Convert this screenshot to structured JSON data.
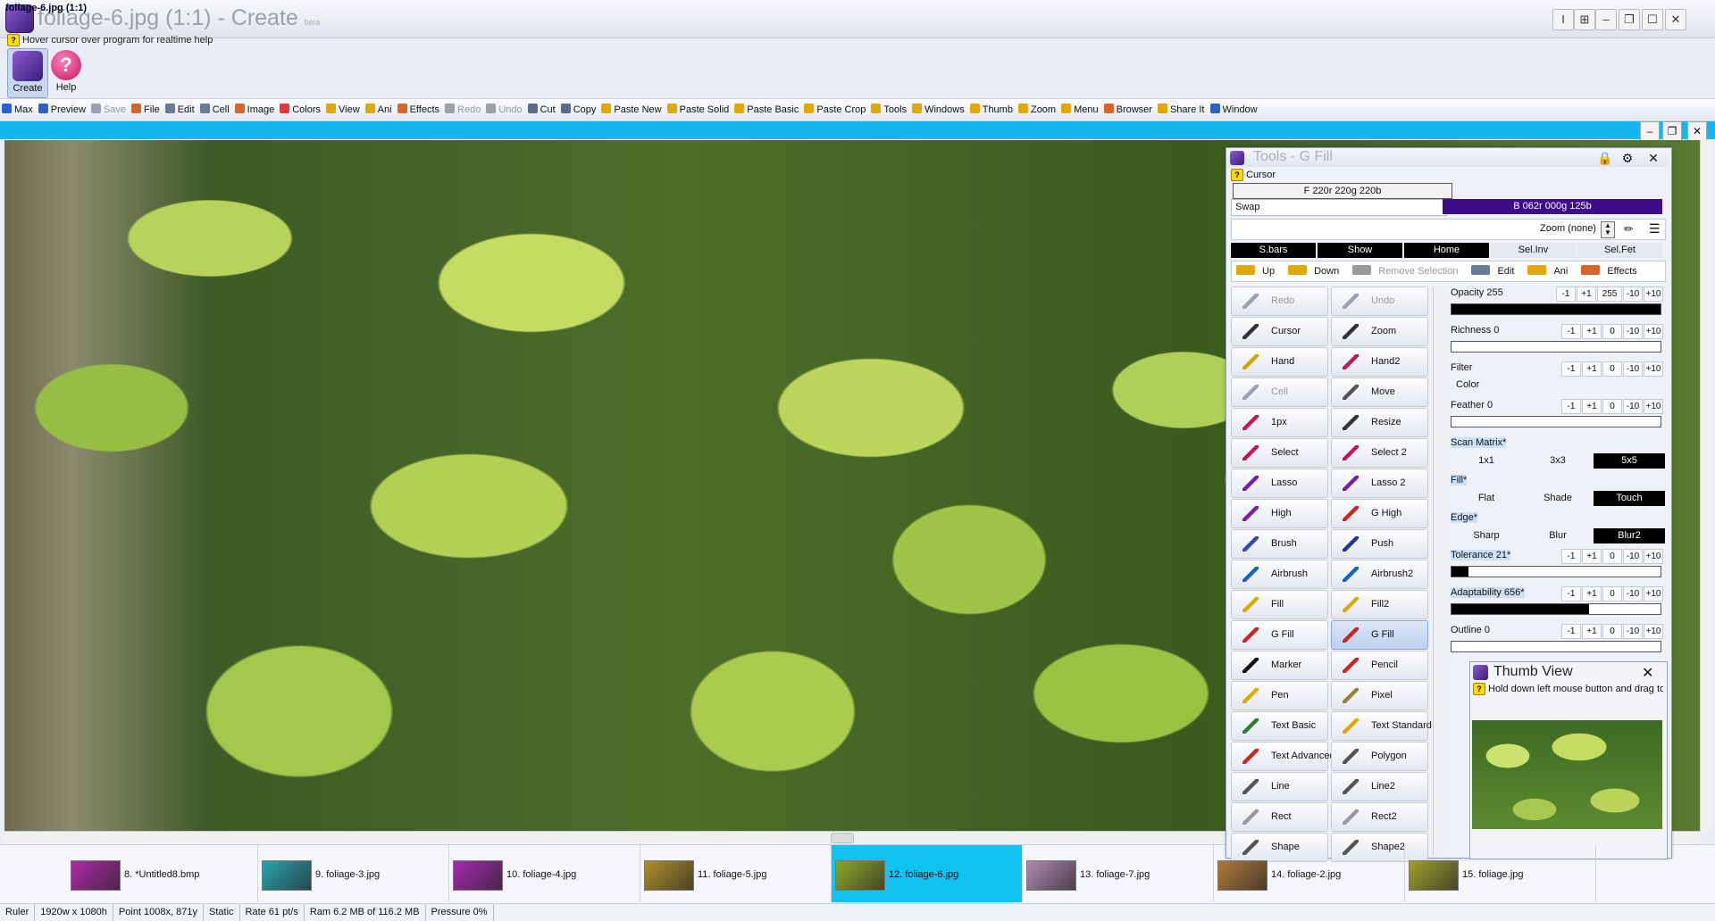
{
  "window": {
    "title": "foliage-6.jpg (1:1) - Create",
    "title_suffix": "beta",
    "hint": "Hover cursor over program for realtime help",
    "controls": [
      "I",
      "⊞",
      "–",
      "❐",
      "☐",
      "✕"
    ]
  },
  "big_buttons": {
    "create": "Create",
    "help": "Help"
  },
  "menubar": [
    {
      "label": "Max",
      "icon": "max-icon",
      "color": "#2a62c9",
      "enabled": true
    },
    {
      "label": "Preview",
      "icon": "preview-icon",
      "color": "#2a62c9",
      "enabled": true
    },
    {
      "label": "Save",
      "icon": "save-icon",
      "color": "#9aa0ad",
      "enabled": false
    },
    {
      "label": "File",
      "icon": "file-icon",
      "color": "#d9642a",
      "enabled": true
    },
    {
      "label": "Edit",
      "icon": "edit-icon",
      "color": "#6a7a9a",
      "enabled": true
    },
    {
      "label": "Cell",
      "icon": "cell-icon",
      "color": "#6a7a9a",
      "enabled": true
    },
    {
      "label": "Image",
      "icon": "image-icon",
      "color": "#d9642a",
      "enabled": true
    },
    {
      "label": "Colors",
      "icon": "colors-icon",
      "color": "#e53935",
      "enabled": true
    },
    {
      "label": "View",
      "icon": "view-icon",
      "color": "#e0a800",
      "enabled": true
    },
    {
      "label": "Ani",
      "icon": "ani-icon",
      "color": "#e0a800",
      "enabled": true
    },
    {
      "label": "Effects",
      "icon": "effects-icon",
      "color": "#d9642a",
      "enabled": true
    },
    {
      "label": "Redo",
      "icon": "redo-icon",
      "color": "#9aa0ad",
      "enabled": false
    },
    {
      "label": "Undo",
      "icon": "undo-icon",
      "color": "#9aa0ad",
      "enabled": false
    },
    {
      "label": "Cut",
      "icon": "cut-icon",
      "color": "#5a6b8c",
      "enabled": true
    },
    {
      "label": "Copy",
      "icon": "copy-icon",
      "color": "#5a6b8c",
      "enabled": true
    },
    {
      "label": "Paste New",
      "icon": "paste-icon",
      "color": "#e0a800",
      "enabled": true
    },
    {
      "label": "Paste Solid",
      "icon": "paste-icon",
      "color": "#e0a800",
      "enabled": true
    },
    {
      "label": "Paste Basic",
      "icon": "paste-icon",
      "color": "#e0a800",
      "enabled": true
    },
    {
      "label": "Paste Crop",
      "icon": "paste-icon",
      "color": "#e0a800",
      "enabled": true
    },
    {
      "label": "Tools",
      "icon": "tools-icon",
      "color": "#e0a800",
      "enabled": true
    },
    {
      "label": "Windows",
      "icon": "windows-icon",
      "color": "#e0a800",
      "enabled": true
    },
    {
      "label": "Thumb",
      "icon": "thumb-icon",
      "color": "#e0a800",
      "enabled": true
    },
    {
      "label": "Zoom",
      "icon": "zoom-icon",
      "color": "#e0a800",
      "enabled": true
    },
    {
      "label": "Menu",
      "icon": "menu-icon",
      "color": "#e0a800",
      "enabled": true
    },
    {
      "label": "Browser",
      "icon": "browser-icon",
      "color": "#d9642a",
      "enabled": true
    },
    {
      "label": "Share It",
      "icon": "share-icon",
      "color": "#e0a800",
      "enabled": true
    },
    {
      "label": "Window",
      "icon": "window-icon",
      "color": "#2a62c9",
      "enabled": true
    }
  ],
  "image_window": {
    "title": "foliage-6.jpg (1:1)",
    "controls": [
      "–",
      "❐",
      "✕"
    ]
  },
  "thumbnails": [
    {
      "label": "8. *Untitled8.bmp",
      "color": "#b02aa8",
      "active": false
    },
    {
      "label": "9. foliage-3.jpg",
      "color": "#2aa5b0",
      "active": false
    },
    {
      "label": "10. foliage-4.jpg",
      "color": "#a52ab0",
      "active": false
    },
    {
      "label": "11. foliage-5.jpg",
      "color": "#b0902a",
      "active": false
    },
    {
      "label": "12. foliage-6.jpg",
      "color": "#8aa82a",
      "active": true
    },
    {
      "label": "13. foliage-7.jpg",
      "color": "#b08ab0",
      "active": false
    },
    {
      "label": "14. foliage-2.jpg",
      "color": "#b07a3a",
      "active": false
    },
    {
      "label": "15. foliage.jpg",
      "color": "#a0a030",
      "active": false
    }
  ],
  "status": [
    "Ruler",
    "1920w x 1080h",
    "Point 1008x, 871y",
    "Static",
    "Rate 61 pt/s",
    "Ram 6.2 MB of 116.2 MB",
    "Pressure 0%"
  ],
  "tools_panel": {
    "title": "Tools - G Fill",
    "cursor_label": "Cursor",
    "fg_color": "F  220r 220g 220b",
    "swap": "Swap",
    "bg_color": "B  062r 000g 125b",
    "zoom": "Zoom  (none)",
    "tabs": [
      {
        "label": "S.bars",
        "dark": true
      },
      {
        "label": "Show",
        "dark": true
      },
      {
        "label": "Home",
        "dark": true
      },
      {
        "label": "Sel.Inv",
        "dark": false
      },
      {
        "label": "Sel.Fet",
        "dark": false
      }
    ],
    "subbar": [
      {
        "label": "Up",
        "icon": "up-arrow-icon",
        "enabled": true
      },
      {
        "label": "Down",
        "icon": "down-arrow-icon",
        "enabled": true
      },
      {
        "label": "Remove Selection",
        "icon": "remove-selection-icon",
        "enabled": false
      },
      {
        "label": "Edit",
        "icon": "edit-icon",
        "enabled": true
      },
      {
        "label": "Ani",
        "icon": "ani-icon",
        "enabled": true
      },
      {
        "label": "Effects",
        "icon": "effects-icon",
        "enabled": true
      }
    ],
    "tools": [
      {
        "label": "Redo",
        "icon": "redo-icon",
        "color": "#9aa0ad",
        "enabled": false
      },
      {
        "label": "Undo",
        "icon": "undo-icon",
        "color": "#9aa0ad",
        "enabled": false
      },
      {
        "label": "Cursor",
        "icon": "cursor-icon",
        "color": "#333333",
        "enabled": true
      },
      {
        "label": "Zoom",
        "icon": "zoom-icon",
        "color": "#333333",
        "enabled": true
      },
      {
        "label": "Hand",
        "icon": "hand-icon",
        "color": "#d9a200",
        "enabled": true
      },
      {
        "label": "Hand2",
        "icon": "hand2-icon",
        "color": "#c2185b",
        "enabled": true
      },
      {
        "label": "Cell",
        "icon": "cell-icon",
        "color": "#9aa0ad",
        "enabled": false
      },
      {
        "label": "Move",
        "icon": "move-icon",
        "color": "#555555",
        "enabled": true
      },
      {
        "label": "1px",
        "icon": "pencil-1px-icon",
        "color": "#c2185b",
        "enabled": true
      },
      {
        "label": "Resize",
        "icon": "resize-icon",
        "color": "#333333",
        "enabled": true
      },
      {
        "label": "Select",
        "icon": "select-icon",
        "color": "#c2185b",
        "enabled": true
      },
      {
        "label": "Select 2",
        "icon": "select2-icon",
        "color": "#c2185b",
        "enabled": true
      },
      {
        "label": "Lasso",
        "icon": "lasso-icon",
        "color": "#7b1fa2",
        "enabled": true
      },
      {
        "label": "Lasso 2",
        "icon": "lasso2-icon",
        "color": "#7b1fa2",
        "enabled": true
      },
      {
        "label": "High",
        "icon": "highlighter-icon",
        "color": "#7b1fa2",
        "enabled": true
      },
      {
        "label": "G High",
        "icon": "g-high-icon",
        "color": "#c62828",
        "enabled": true
      },
      {
        "label": "Brush",
        "icon": "brush-icon",
        "color": "#3949ab",
        "enabled": true
      },
      {
        "label": "Push",
        "icon": "push-icon",
        "color": "#1e3a8a",
        "enabled": true
      },
      {
        "label": "Airbrush",
        "icon": "airbrush-icon",
        "color": "#1565c0",
        "enabled": true
      },
      {
        "label": "Airbrush2",
        "icon": "airbrush2-icon",
        "color": "#1565c0",
        "enabled": true
      },
      {
        "label": "Fill",
        "icon": "fill-icon",
        "color": "#e0a800",
        "enabled": true
      },
      {
        "label": "Fill2",
        "icon": "fill2-icon",
        "color": "#e0a800",
        "enabled": true
      },
      {
        "label": "G Fill",
        "icon": "g-fill-icon",
        "color": "#c62828",
        "enabled": true
      },
      {
        "label": "G Fill",
        "icon": "g-fill-icon",
        "color": "#c62828",
        "enabled": true
      },
      {
        "label": "Marker",
        "icon": "marker-icon",
        "color": "#111111",
        "enabled": true
      },
      {
        "label": "Pencil",
        "icon": "pencil-icon",
        "color": "#c62828",
        "enabled": true
      },
      {
        "label": "Pen",
        "icon": "pen-icon",
        "color": "#e0a800",
        "enabled": true
      },
      {
        "label": "Pixel",
        "icon": "pixel-icon",
        "color": "#8a8a3a",
        "enabled": true
      },
      {
        "label": "Text Basic",
        "icon": "text-basic-icon",
        "color": "#2e7d32",
        "enabled": true
      },
      {
        "label": "Text Standard",
        "icon": "text-standard-icon",
        "color": "#e0a800",
        "enabled": true
      },
      {
        "label": "Text Advanced",
        "icon": "text-advanced-icon",
        "color": "#c62828",
        "enabled": true
      },
      {
        "label": "Polygon",
        "icon": "polygon-icon",
        "color": "#555555",
        "enabled": true
      },
      {
        "label": "Line",
        "icon": "line-icon",
        "color": "#555555",
        "enabled": true
      },
      {
        "label": "Line2",
        "icon": "line2-icon",
        "color": "#555555",
        "enabled": true
      },
      {
        "label": "Rect",
        "icon": "rect-icon",
        "color": "#999999",
        "enabled": true
      },
      {
        "label": "Rect2",
        "icon": "rect2-icon",
        "color": "#999999",
        "enabled": true
      },
      {
        "label": "Shape",
        "icon": "shape-icon",
        "color": "#555555",
        "enabled": true
      },
      {
        "label": "Shape2",
        "icon": "shape2-icon",
        "color": "#555555",
        "enabled": true
      }
    ],
    "selected_tool": "G Fill",
    "settings": {
      "opacity": {
        "label": "Opacity 255",
        "value": 255,
        "max": 255
      },
      "richness": {
        "label": "Richness 0",
        "value": 0,
        "max": 255
      },
      "filter": {
        "label": "Filter",
        "sub": "Color"
      },
      "feather": {
        "label": "Feather 0",
        "value": 0,
        "max": 255
      },
      "scan_matrix": {
        "label": "Scan Matrix*",
        "options": [
          "1x1",
          "3x3",
          "5x5"
        ],
        "selected": "5x5"
      },
      "fill": {
        "label": "Fill*",
        "options": [
          "Flat",
          "Shade",
          "Touch"
        ],
        "selected": "Touch"
      },
      "edge": {
        "label": "Edge*",
        "options": [
          "Sharp",
          "Blur",
          "Blur2"
        ],
        "selected": "Blur2"
      },
      "tolerance": {
        "label": "Tolerance 21*",
        "value": 21,
        "max": 255
      },
      "adaptability": {
        "label": "Adaptability 656*",
        "value": 656,
        "max": 1000
      },
      "outline": {
        "label": "Outline 0",
        "value": 0,
        "max": 255
      }
    },
    "stepper_full": [
      "-1",
      "+1",
      "255",
      "-10",
      "+10"
    ],
    "stepper": [
      "-1",
      "+1",
      "0",
      "-10",
      "+10"
    ]
  },
  "thumb_view": {
    "title": "Thumb View",
    "hint": "Hold down left mouse button and drag to"
  }
}
